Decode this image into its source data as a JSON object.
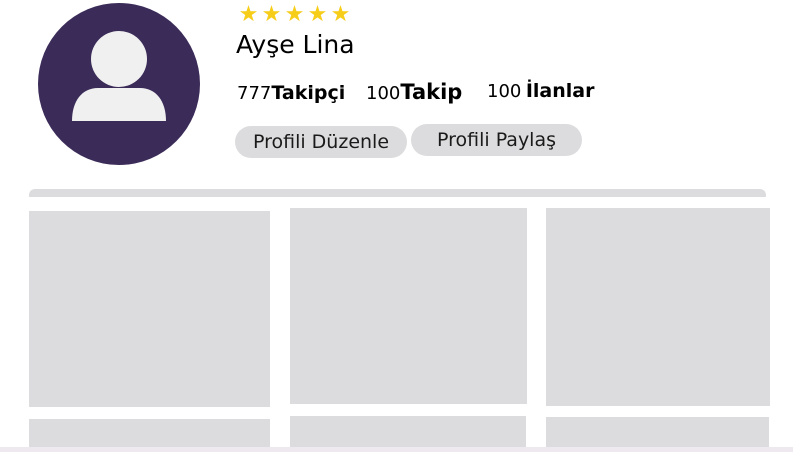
{
  "profile": {
    "name": "Ayşe Lina",
    "rating_stars": 5,
    "stars_text": "★★★★★"
  },
  "stats": [
    {
      "count": "777",
      "label": "Takipçi"
    },
    {
      "count": "100",
      "label": "Takip"
    },
    {
      "count": "100",
      "label": "İlanlar"
    }
  ],
  "actions": {
    "edit_label": "Profili Düzenle",
    "share_label": "Profili Paylaş"
  },
  "colors": {
    "avatar_bg": "#3b2b58",
    "avatar_figure": "#f0f0f0",
    "star": "#f6cd18",
    "button_bg": "#dcdcde",
    "tile_bg": "#dcdcde"
  },
  "icons": {
    "avatar": "user-silhouette-icon",
    "rating": "star-icon"
  },
  "grid": {
    "tile_count": 6
  }
}
